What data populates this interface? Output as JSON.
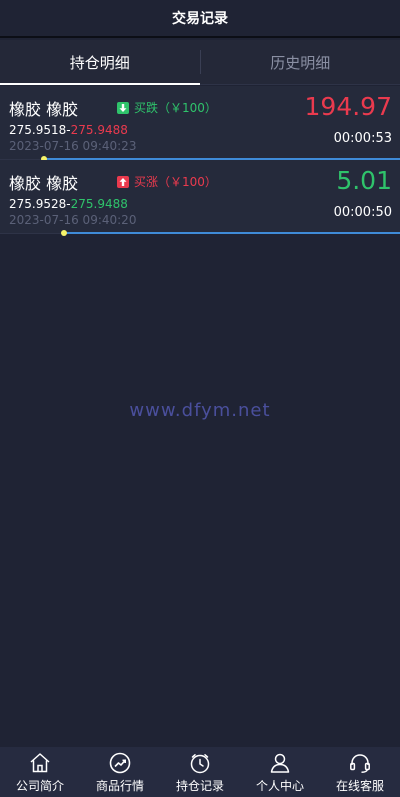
{
  "header": {
    "title": "交易记录"
  },
  "tabs": [
    {
      "label": "持仓明细",
      "active": true
    },
    {
      "label": "历史明细",
      "active": false
    }
  ],
  "positions": [
    {
      "name": "橡胶 橡胶",
      "direction": "down",
      "direction_label": "买跌（￥100）",
      "open_price": "275.9518",
      "separator": "-",
      "current_price": "275.9488",
      "current_price_color": "red",
      "time": "2023-07-16 09:40:23",
      "profit": "194.97",
      "profit_color": "red",
      "countdown": "00:00:53",
      "progress": 0.89
    },
    {
      "name": "橡胶 橡胶",
      "direction": "up",
      "direction_label": "买涨（￥100）",
      "open_price": "275.9528",
      "separator": "-",
      "current_price": "275.9488",
      "current_price_color": "green",
      "time": "2023-07-16 09:40:20",
      "profit": "5.01",
      "profit_color": "green",
      "countdown": "00:00:50",
      "progress": 0.84
    }
  ],
  "watermark": "www.dfym.net",
  "bottom_nav": [
    {
      "label": "公司简介",
      "icon": "home-icon"
    },
    {
      "label": "商品行情",
      "icon": "trend-icon"
    },
    {
      "label": "持仓记录",
      "icon": "timer-icon"
    },
    {
      "label": "个人中心",
      "icon": "user-icon"
    },
    {
      "label": "在线客服",
      "icon": "headset-icon"
    }
  ],
  "colors": {
    "background": "#1f2334",
    "card": "#252a3b",
    "red": "#ea3a4e",
    "green": "#2fc36b",
    "progress": "#3f8bd8",
    "knob": "#f5f36a"
  }
}
